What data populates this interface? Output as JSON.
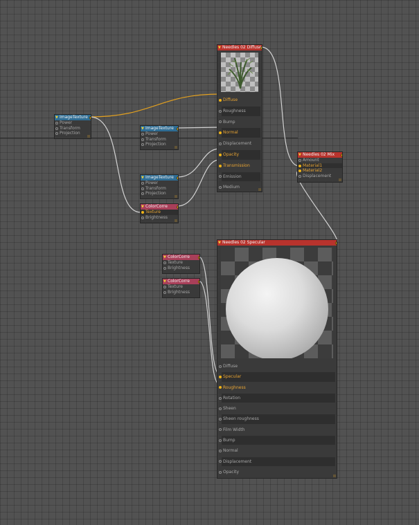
{
  "colors": {
    "canvas": "#525252",
    "wire_gray": "#d2d2d2",
    "wire_orange": "#e2a020",
    "header_blue": "#2f6d94",
    "header_pink": "#a83f59",
    "header_red": "#b8332d",
    "port_active": "#f0b418"
  },
  "icons": {
    "collapse": "triangle-down-icon",
    "port": "socket-circle-icon",
    "resize": "resize-grip-icon"
  },
  "nodes": {
    "imagetexture1": {
      "title": "ImageTexture",
      "inputs": [
        "Power",
        "Transform",
        "Projection"
      ]
    },
    "imagetexture2": {
      "title": "ImageTexture",
      "inputs": [
        "Power",
        "Transform",
        "Projection"
      ]
    },
    "imagetexture3": {
      "title": "ImageTexture",
      "inputs": [
        "Power",
        "Transform",
        "Projection"
      ]
    },
    "colorcorrect1": {
      "title": "ColorCorre",
      "inputs": [
        "Texture",
        "Brightness"
      ]
    },
    "colorcorrect2": {
      "title": "ColorCorre",
      "inputs": [
        "Texture",
        "Brightness"
      ]
    },
    "colorcorrect3": {
      "title": "ColorCorre",
      "inputs": [
        "Texture",
        "Brightness"
      ]
    },
    "diffuse": {
      "title": "Needles 02 Diffuse",
      "inputs": [
        "Diffuse",
        "Roughness",
        "Bump",
        "Normal",
        "Displacement",
        "Opacity",
        "Transmission",
        "Emission",
        "Medium"
      ]
    },
    "mix": {
      "title": "Needles 02 Mix",
      "inputs": [
        "Amount",
        "Material1",
        "Material2",
        "Displacement"
      ]
    },
    "specular": {
      "title": "Needles 02 Specular",
      "inputs": [
        "Diffuse",
        "Specular",
        "Roughness",
        "Rotation",
        "Sheen",
        "Sheen roughness",
        "Film Width",
        "Bump",
        "Normal",
        "Displacement",
        "Opacity"
      ]
    }
  }
}
